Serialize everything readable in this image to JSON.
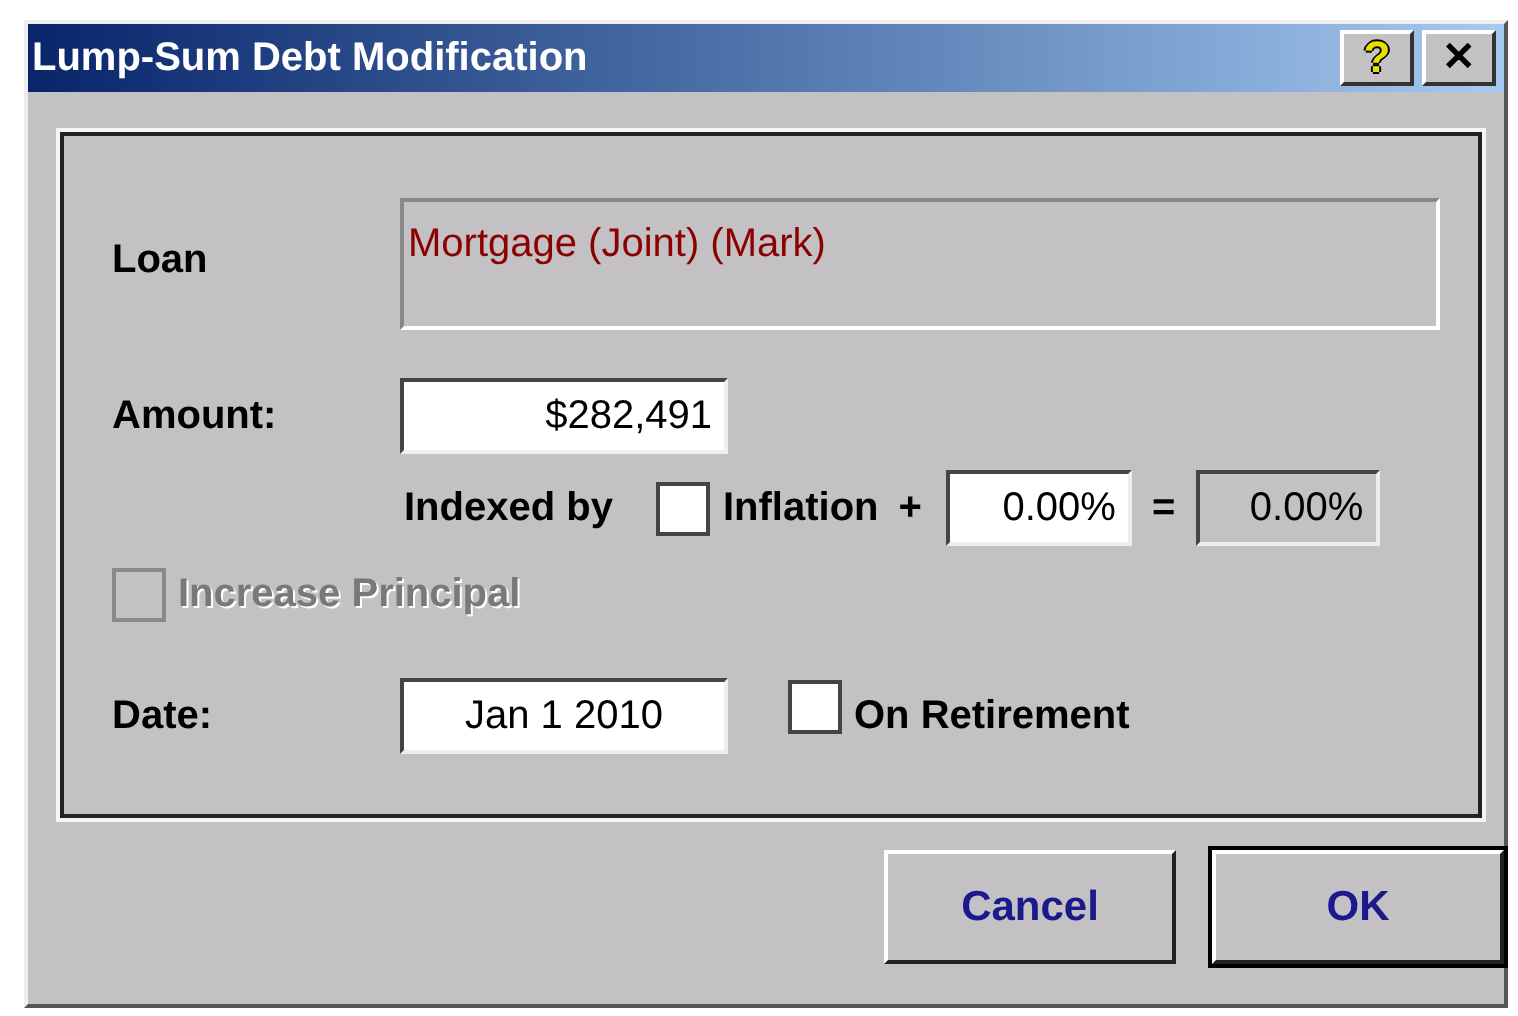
{
  "window": {
    "title": "Lump-Sum Debt Modification",
    "help_icon": "?",
    "close_icon": "✕"
  },
  "loan": {
    "label": "Loan",
    "value": "Mortgage (Joint) (Mark)"
  },
  "amount": {
    "label": "Amount:",
    "value": "$282,491"
  },
  "indexed": {
    "label": "Indexed by",
    "inflation": {
      "label": "Inflation",
      "checked": false
    },
    "plus": "+",
    "rate": "0.00%",
    "equals": "=",
    "total": "0.00%"
  },
  "increase_principal": {
    "label": "Increase Principal",
    "checked": false,
    "disabled": true
  },
  "date": {
    "label": "Date:",
    "value": "Jan 1 2010",
    "on_retirement": {
      "label": "On Retirement",
      "checked": false
    }
  },
  "buttons": [
    {
      "label": "Cancel",
      "default": false
    },
    {
      "label": "OK",
      "default": true
    }
  ]
}
